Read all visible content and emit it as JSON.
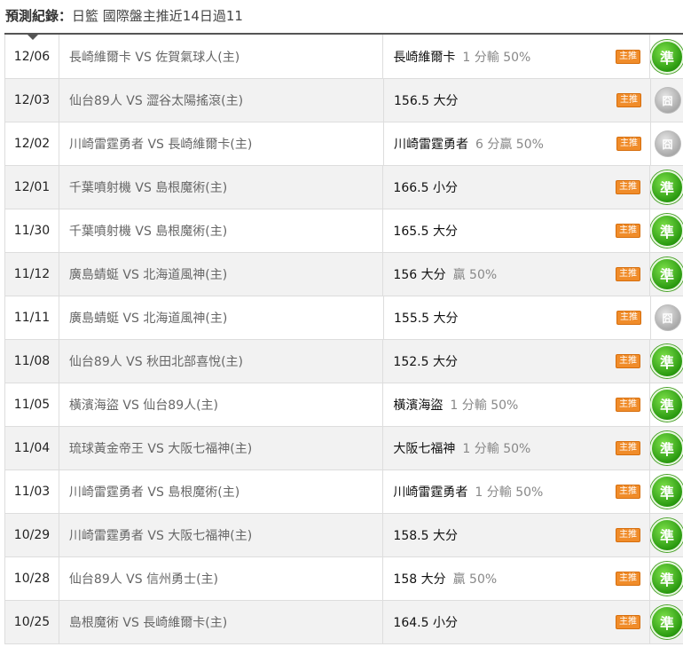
{
  "header": {
    "title_bold": "預測紀錄：",
    "title_rest": "日籃 國際盤主推近14日過11"
  },
  "badge_label": "主推",
  "rows": [
    {
      "date": "12/06",
      "match": "長崎維爾卡 VS 佐賀氣球人(主)",
      "pick": "長崎維爾卡",
      "extra": "1 分輸 50%",
      "result": "準",
      "result_type": "win"
    },
    {
      "date": "12/03",
      "match": "仙台89人 VS 澀谷太陽搖滾(主)",
      "pick": "156.5 大分",
      "extra": "",
      "result": "囧",
      "result_type": "void"
    },
    {
      "date": "12/02",
      "match": "川崎雷霆勇者 VS 長崎維爾卡(主)",
      "pick": "川崎雷霆勇者",
      "extra": "6 分贏 50%",
      "result": "囧",
      "result_type": "void"
    },
    {
      "date": "12/01",
      "match": "千葉噴射機 VS 島根魔術(主)",
      "pick": "166.5 小分",
      "extra": "",
      "result": "準",
      "result_type": "win"
    },
    {
      "date": "11/30",
      "match": "千葉噴射機 VS 島根魔術(主)",
      "pick": "165.5 大分",
      "extra": "",
      "result": "準",
      "result_type": "win"
    },
    {
      "date": "11/12",
      "match": "廣島蜻蜓 VS 北海道風神(主)",
      "pick": "156 大分",
      "extra": "贏 50%",
      "result": "準",
      "result_type": "win"
    },
    {
      "date": "11/11",
      "match": "廣島蜻蜓 VS 北海道風神(主)",
      "pick": "155.5 大分",
      "extra": "",
      "result": "囧",
      "result_type": "void"
    },
    {
      "date": "11/08",
      "match": "仙台89人 VS 秋田北部喜悅(主)",
      "pick": "152.5 大分",
      "extra": "",
      "result": "準",
      "result_type": "win"
    },
    {
      "date": "11/05",
      "match": "橫濱海盜 VS 仙台89人(主)",
      "pick": "橫濱海盜",
      "extra": "1 分輸 50%",
      "result": "準",
      "result_type": "win"
    },
    {
      "date": "11/04",
      "match": "琉球黃金帝王 VS 大阪七福神(主)",
      "pick": "大阪七福神",
      "extra": "1 分輸 50%",
      "result": "準",
      "result_type": "win"
    },
    {
      "date": "11/03",
      "match": "川崎雷霆勇者 VS 島根魔術(主)",
      "pick": "川崎雷霆勇者",
      "extra": "1 分輸 50%",
      "result": "準",
      "result_type": "win"
    },
    {
      "date": "10/29",
      "match": "川崎雷霆勇者 VS 大阪七福神(主)",
      "pick": "158.5 大分",
      "extra": "",
      "result": "準",
      "result_type": "win"
    },
    {
      "date": "10/28",
      "match": "仙台89人 VS 信州勇士(主)",
      "pick": "158 大分",
      "extra": "贏 50%",
      "result": "準",
      "result_type": "win"
    },
    {
      "date": "10/25",
      "match": "島根魔術 VS 長崎維爾卡(主)",
      "pick": "164.5 小分",
      "extra": "",
      "result": "準",
      "result_type": "win"
    }
  ]
}
